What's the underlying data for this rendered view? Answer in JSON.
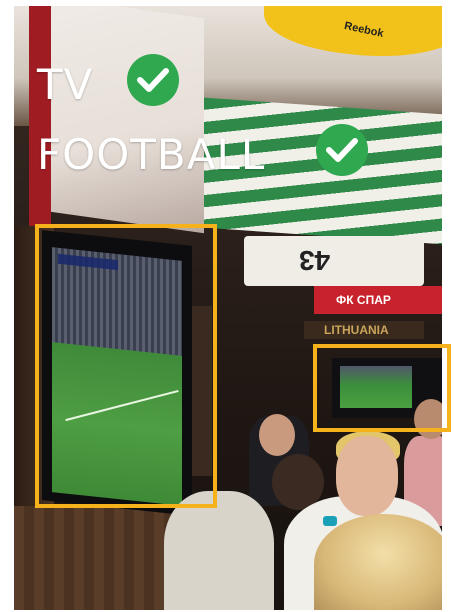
{
  "overlay": {
    "line1": "TV",
    "line2": "FOOTBALL",
    "check_color": "#2fa84f",
    "highlight_color": "#f5b21a"
  },
  "scene": {
    "description_icon_names": [
      "check-circle-icon",
      "check-circle-icon"
    ],
    "signage": {
      "umbrella_brand": "Reebok",
      "jersey_number": "43",
      "club_banner": "ФК СПАР",
      "bar_sign": "LITHUANIA"
    }
  }
}
